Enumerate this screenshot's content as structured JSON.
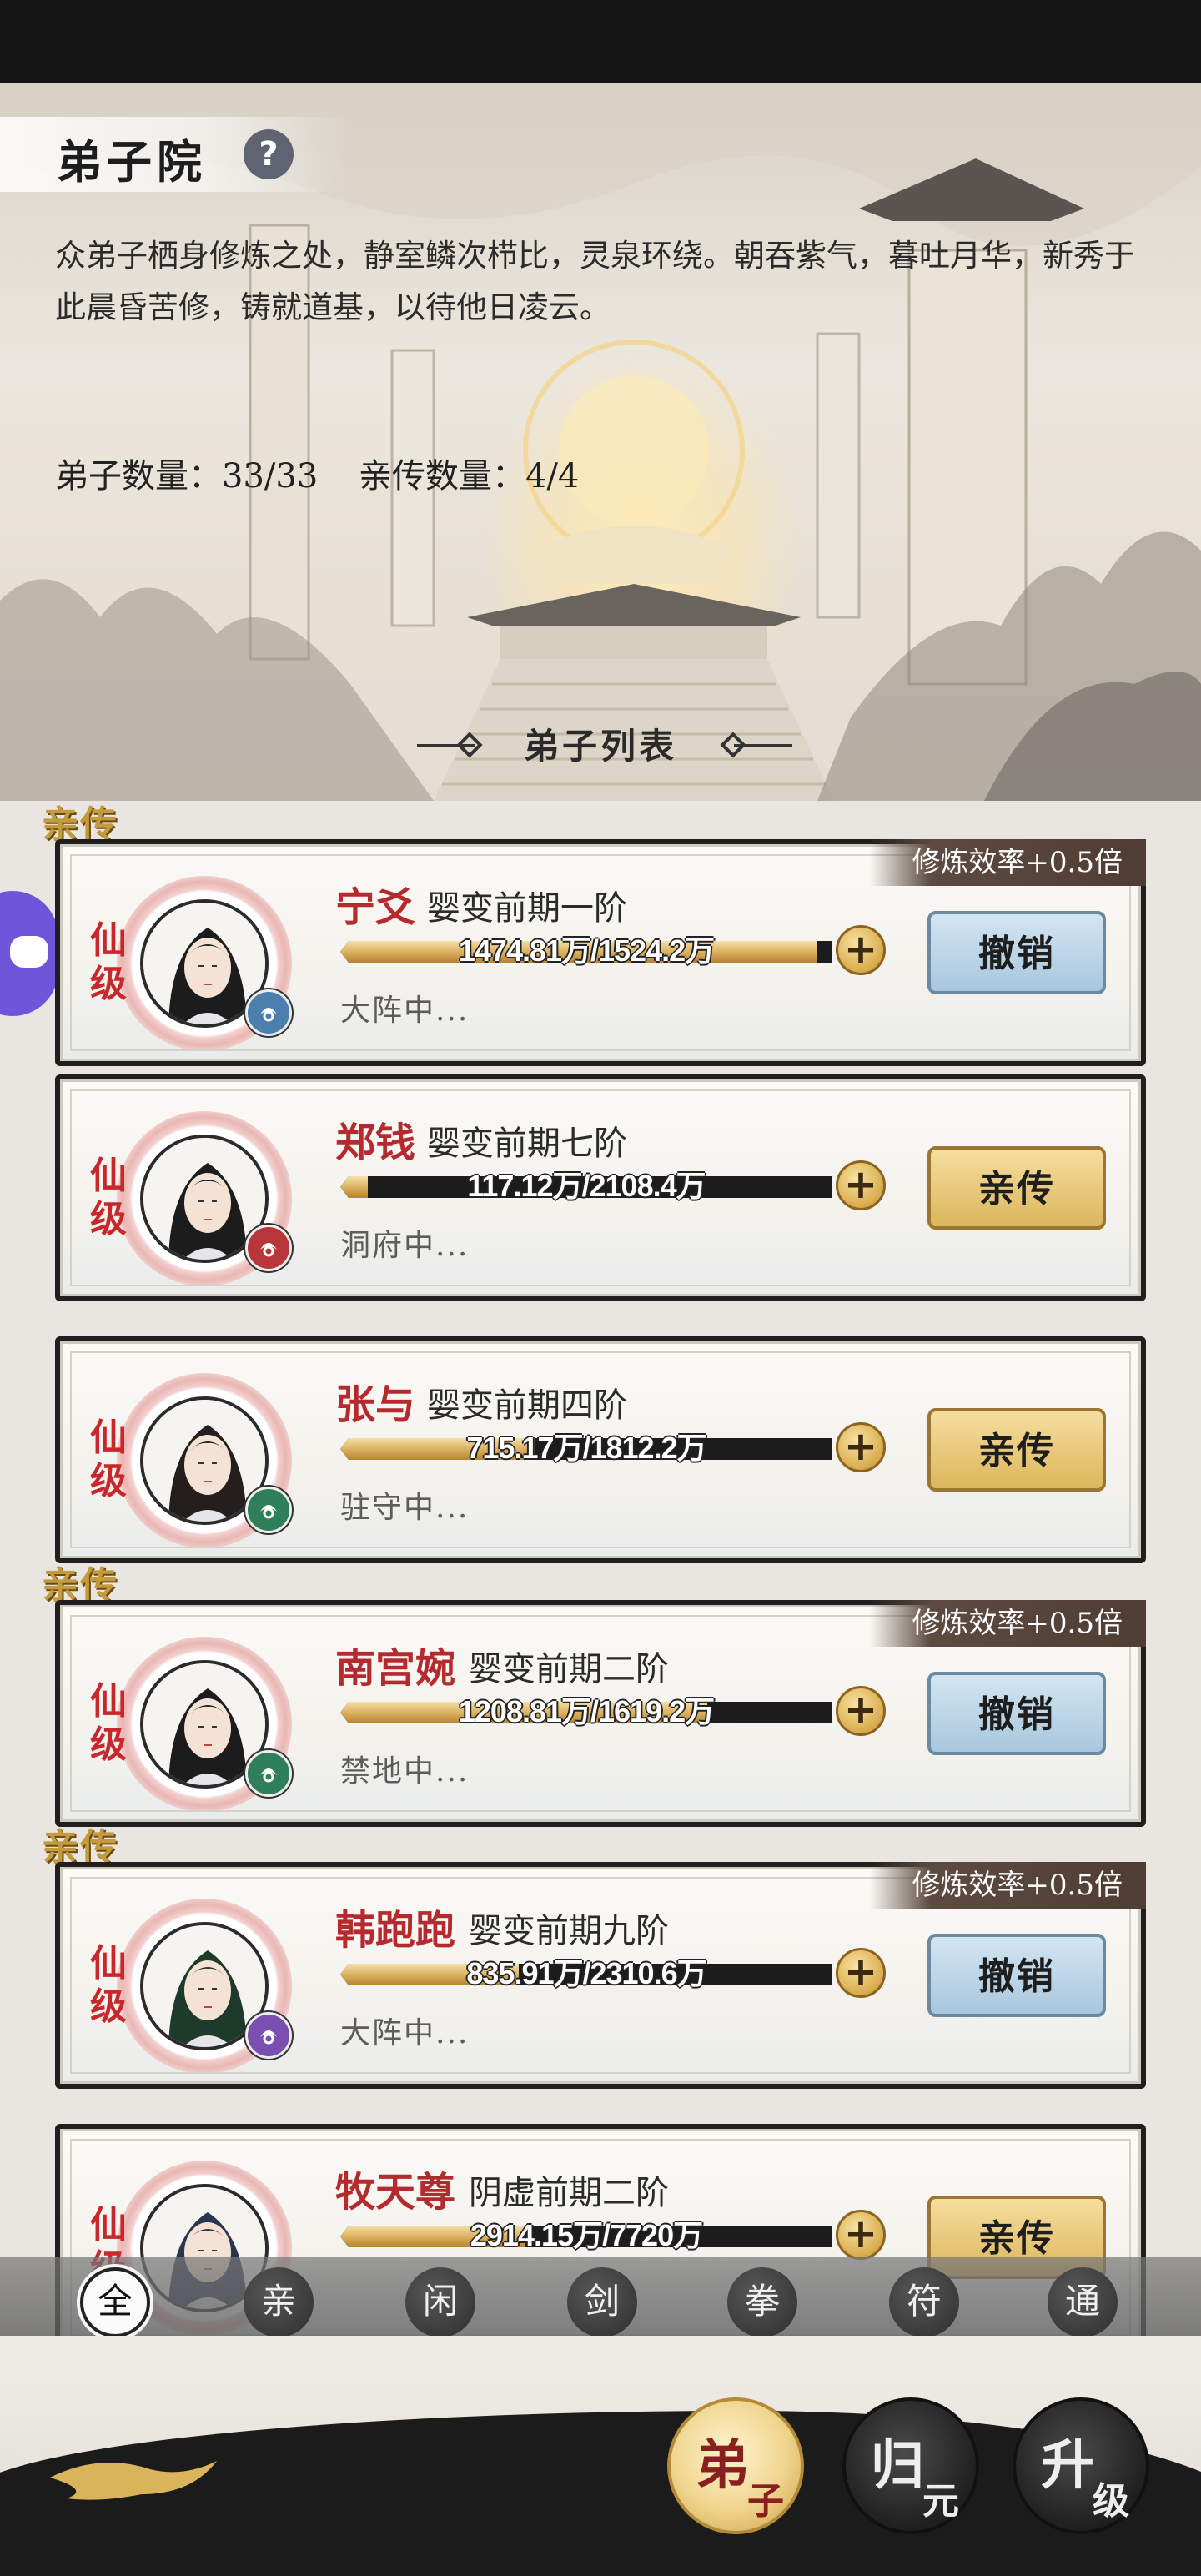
{
  "page": {
    "title": "弟子院",
    "help_icon": "?",
    "description": "众弟子栖身修炼之处，静室鳞次栉比，灵泉环绕。朝吞紫气，暮吐月华，新秀于此晨昏苦修，铸就道基，以待他日凌云。",
    "disciple_count": "弟子数量：33/33",
    "direct_count": "亲传数量：4/4",
    "list_title": "弟子列表"
  },
  "disciples": [
    {
      "name": "宁爻",
      "realm": "婴变前期一阶",
      "progress_text": "1474.81万/1524.2万",
      "progress": 0.968,
      "status": "大阵中...",
      "grade": "仙级",
      "direct": true,
      "direct_tag": "亲传",
      "efficiency": "修炼效率+0.5倍",
      "action": "撤销",
      "action_type": "revoke",
      "sect_icon": "sword-sect-icon",
      "sect_color": "#4a7fae"
    },
    {
      "name": "郑钱",
      "realm": "婴变前期七阶",
      "progress_text": "117.12万/2108.4万",
      "progress": 0.056,
      "status": "洞府中...",
      "grade": "仙级",
      "direct": false,
      "action": "亲传",
      "action_type": "appoint",
      "sect_icon": "fist-sect-icon",
      "sect_color": "#b8363a"
    },
    {
      "name": "张与",
      "realm": "婴变前期四阶",
      "progress_text": "715.17万/1812.2万",
      "progress": 0.395,
      "status": "驻守中...",
      "grade": "仙级",
      "direct": false,
      "action": "亲传",
      "action_type": "appoint",
      "sect_icon": "wind-sect-icon",
      "sect_color": "#2f7f5a"
    },
    {
      "name": "南宫婉",
      "realm": "婴变前期二阶",
      "progress_text": "1208.81万/1619.2万",
      "progress": 0.746,
      "status": "禁地中...",
      "grade": "仙级",
      "direct": true,
      "direct_tag": "亲传",
      "efficiency": "修炼效率+0.5倍",
      "action": "撤销",
      "action_type": "revoke",
      "sect_icon": "wind-sect-icon",
      "sect_color": "#2f7f5a"
    },
    {
      "name": "韩跑跑",
      "realm": "婴变前期九阶",
      "progress_text": "835.91万/2310.6万",
      "progress": 0.362,
      "status": "大阵中...",
      "grade": "仙级",
      "direct": true,
      "direct_tag": "亲传",
      "efficiency": "修炼效率+0.5倍",
      "action": "撤销",
      "action_type": "revoke",
      "sect_icon": "spiral-sect-icon",
      "sect_color": "#7a4fb0"
    },
    {
      "name": "牧天尊",
      "realm": "阴虚前期二阶",
      "progress_text": "2914.15万/7720万",
      "progress": 0.377,
      "status": "",
      "grade": "仙级",
      "direct": false,
      "action": "亲传",
      "action_type": "appoint",
      "sect_icon": "",
      "sect_color": "#444444"
    }
  ],
  "filters": [
    "全",
    "亲",
    "闲",
    "剑",
    "拳",
    "符",
    "通"
  ],
  "active_filter": "全",
  "nav": [
    {
      "big": "弟",
      "small": "子",
      "style": "gold"
    },
    {
      "big": "归",
      "small": "元",
      "style": "dark"
    },
    {
      "big": "升",
      "small": "级",
      "style": "dark"
    }
  ],
  "colors": {
    "accent_red": "#b52a2e",
    "gold": "#d8ad5c",
    "revoke_blue": "#a8c7de"
  }
}
